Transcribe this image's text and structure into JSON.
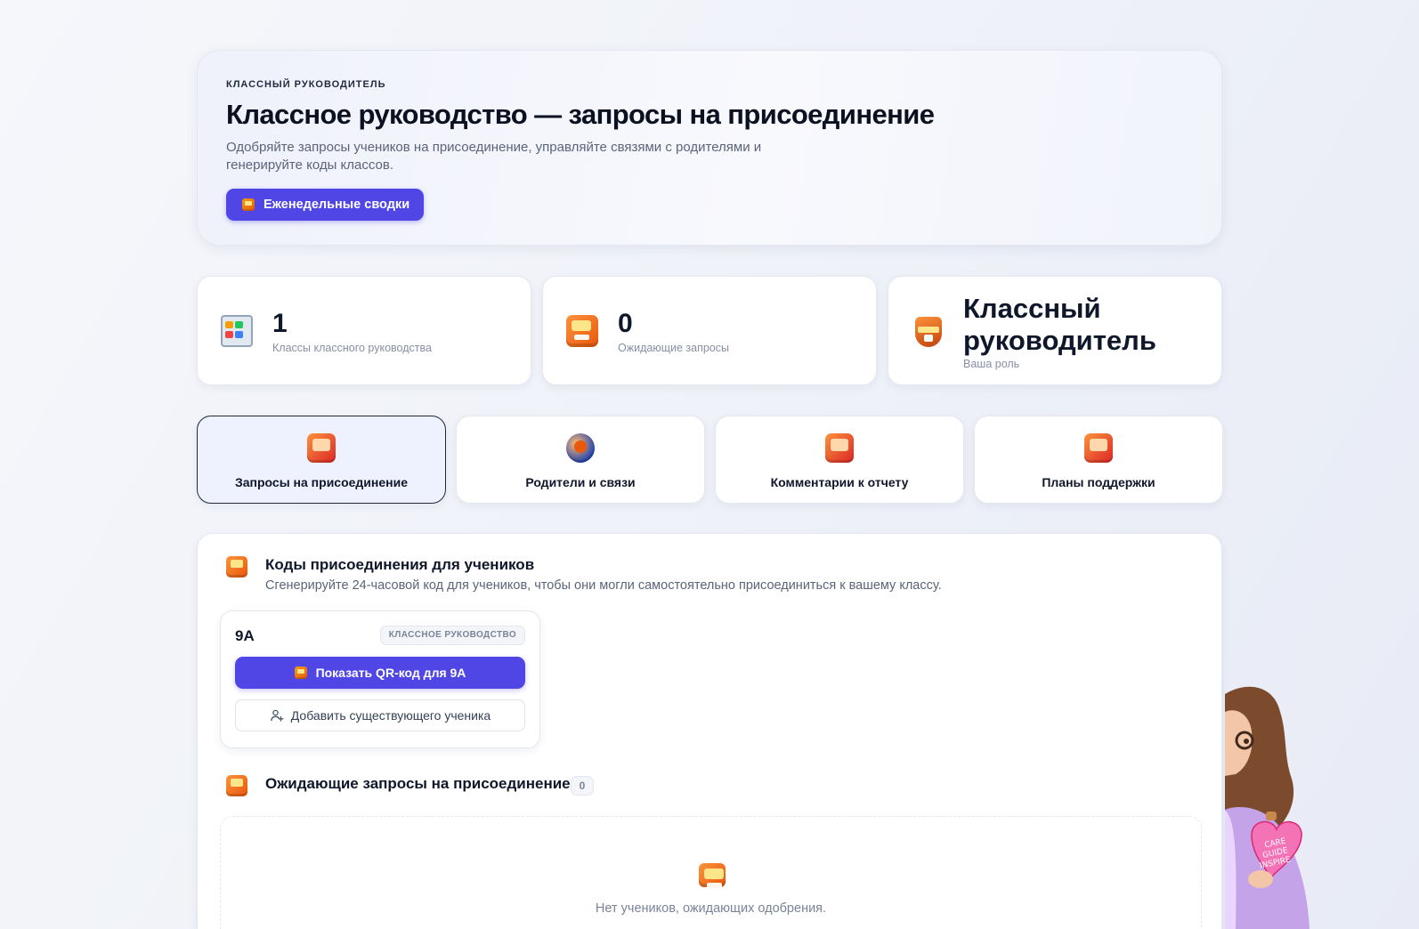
{
  "hero": {
    "eyebrow": "КЛАССНЫЙ РУКОВОДИТЕЛЬ",
    "title": "Классное руководство — запросы на присоединение",
    "description": "Одобряйте запросы учеников на присоединение, управляйте связями с родителями и генерируйте коды классов.",
    "weekly_button": "Еженедельные сводки"
  },
  "stats": [
    {
      "value": "1",
      "label": "Классы классного руководства",
      "icon": "classes-grid-icon"
    },
    {
      "value": "0",
      "label": "Ожидающие запросы",
      "icon": "inbox-icon"
    },
    {
      "value": "Классный руководитель",
      "label": "Ваша роль",
      "icon": "shield-icon"
    }
  ],
  "tabs": [
    {
      "label": "Запросы на присоединение",
      "icon": "join-requests-icon",
      "active": true
    },
    {
      "label": "Родители и связи",
      "icon": "parents-icon",
      "active": false
    },
    {
      "label": "Комментарии к отчету",
      "icon": "report-comments-icon",
      "active": false
    },
    {
      "label": "Планы поддержки",
      "icon": "support-plans-icon",
      "active": false
    }
  ],
  "codes_section": {
    "title": "Коды присоединения для учеников",
    "subtitle": "Сгенерируйте 24-часовой код для учеников, чтобы они могли самостоятельно присоединиться к вашему классу.",
    "class_card": {
      "name": "9A",
      "badge": "КЛАССНОЕ РУКОВОДСТВО",
      "qr_button": "Показать QR-код для 9A",
      "add_button": "Добавить существующего ученика"
    }
  },
  "pending_section": {
    "title": "Ожидающие запросы на присоединение",
    "count": "0",
    "empty_text": "Нет учеников, ожидающих одобрения."
  },
  "mascot": {
    "heart_text_1": "CARE",
    "heart_text_2": "GUIDE",
    "heart_text_3": "INSPIRE"
  },
  "colors": {
    "accent": "#4f46e5",
    "background": "#eef1f8",
    "text": "#0f172a",
    "muted": "#8590a6"
  }
}
